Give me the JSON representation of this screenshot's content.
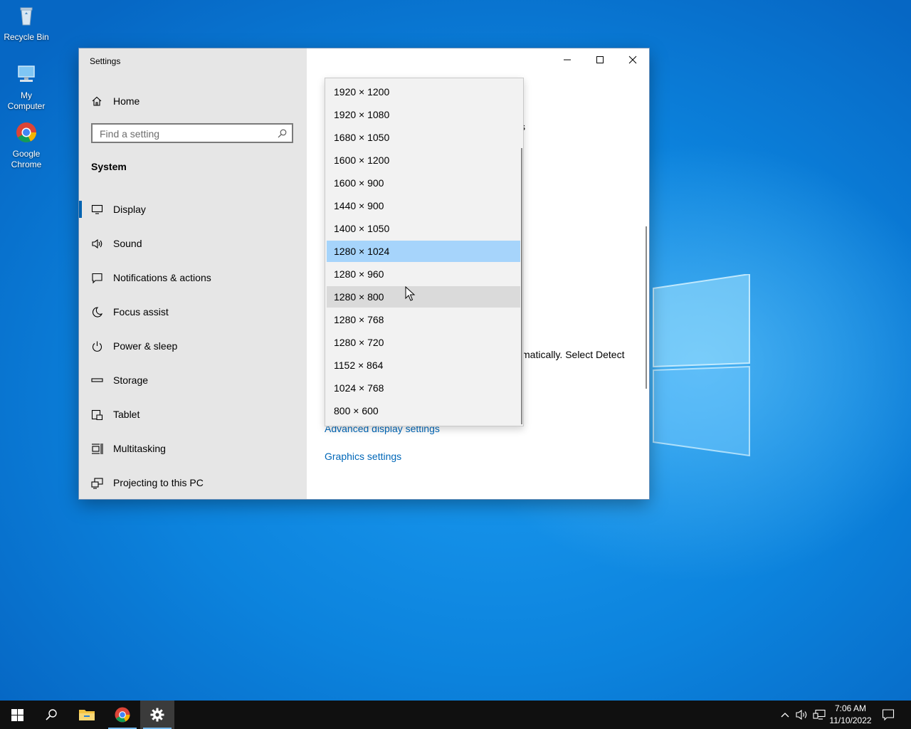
{
  "desktop_icons": [
    {
      "label": "Recycle Bin",
      "icon": "recycle-bin-icon"
    },
    {
      "label": "My\nComputer",
      "icon": "computer-icon"
    },
    {
      "label": "Google\nChrome",
      "icon": "chrome-icon"
    }
  ],
  "window": {
    "title": "Settings",
    "home_label": "Home",
    "search_placeholder": "Find a setting",
    "section_heading": "System",
    "nav_items": [
      {
        "label": "Display",
        "icon": "monitor-icon",
        "active": true
      },
      {
        "label": "Sound",
        "icon": "speaker-icon"
      },
      {
        "label": "Notifications & actions",
        "icon": "notification-icon"
      },
      {
        "label": "Focus assist",
        "icon": "moon-icon"
      },
      {
        "label": "Power & sleep",
        "icon": "power-icon"
      },
      {
        "label": "Storage",
        "icon": "storage-icon"
      },
      {
        "label": "Tablet",
        "icon": "tablet-icon"
      },
      {
        "label": "Multitasking",
        "icon": "multitasking-icon"
      },
      {
        "label": "Projecting to this PC",
        "icon": "projecting-icon"
      }
    ]
  },
  "content": {
    "partial_char": "s",
    "partial_text": "matically. Select Detect",
    "advanced_link": "Advanced display settings",
    "graphics_link": "Graphics settings"
  },
  "resolution_dropdown": {
    "options": [
      "1920 × 1200",
      "1920 × 1080",
      "1680 × 1050",
      "1600 × 1200",
      "1600 × 900",
      "1440 × 900",
      "1400 × 1050",
      "1280 × 1024",
      "1280 × 960",
      "1280 × 800",
      "1280 × 768",
      "1280 × 720",
      "1152 × 864",
      "1024 × 768",
      "800 × 600"
    ],
    "selected": "1280 × 1024",
    "hovered": "1280 × 800"
  },
  "taskbar": {
    "time": "7:06 AM",
    "date": "11/10/2022"
  },
  "colors": {
    "accent": "#0063b1",
    "link": "#0067b8",
    "selected_option": "#a6d4fb",
    "hover_option": "#dadada"
  }
}
